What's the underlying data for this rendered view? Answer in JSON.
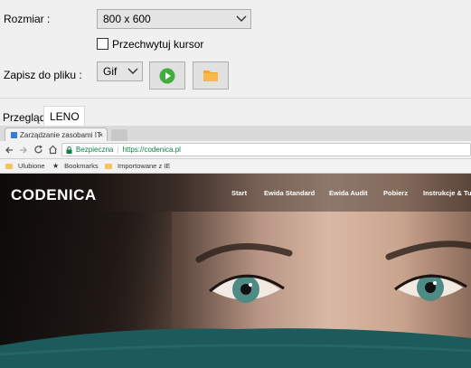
{
  "settings": {
    "size_label": "Rozmiar :",
    "size_value": "800 x 600",
    "capture_cursor_label": "Przechwytuj kursor",
    "capture_cursor_checked": false,
    "save_label": "Zapisz do pliku :",
    "format_value": "Gif",
    "record_button_icon": "play-icon",
    "folder_button_icon": "folder-icon"
  },
  "tabs": [
    {
      "label": "Przegląd",
      "active": false
    },
    {
      "label": "LENO",
      "active": true
    }
  ],
  "browser": {
    "tab_title": "Zarządzanie zasobami IT",
    "secure_label": "Bezpieczna",
    "url": "https://codenica.pl",
    "bookmarks": [
      "Ulubione",
      "Bookmarks",
      "Importowane z IE"
    ]
  },
  "website": {
    "logo": "CODENICA",
    "nav": [
      "Start",
      "Ewida Standard",
      "Ewida Audit",
      "Pobierz",
      "Instrukcje & Tut"
    ]
  },
  "colors": {
    "play_green": "#3fae3f",
    "folder_orange": "#f5a623",
    "secure_green": "#0b8043"
  }
}
